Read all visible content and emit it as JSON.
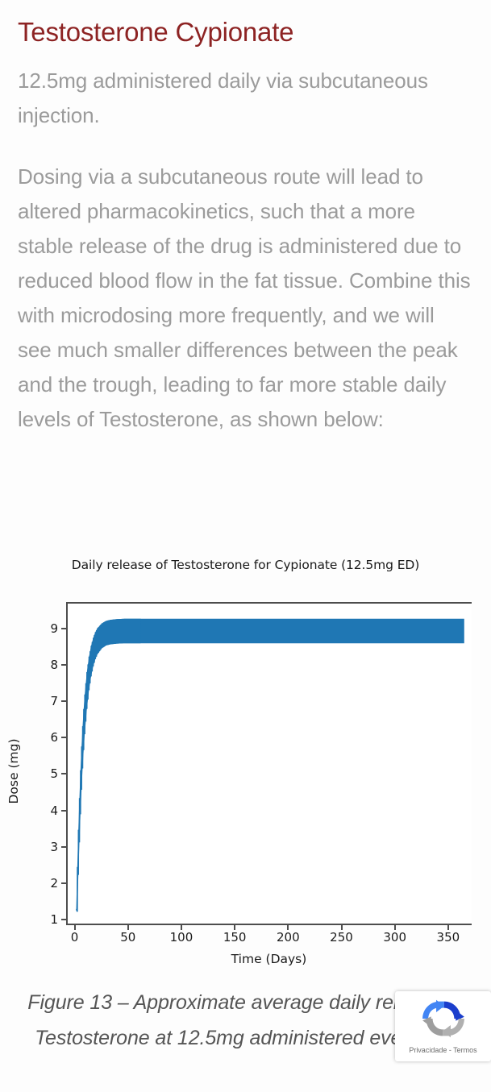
{
  "article": {
    "title": "Testosterone Cypionate",
    "lead": "12.5mg administered daily via subcutaneous injection.",
    "body": "Dosing via a subcutaneous route will lead to altered pharmacokinetics, such that a more stable release of the drug is administered due to reduced blood flow in the fat tissue. Combine this with microdosing more frequently, and we will see much smaller differences between the peak and the trough, leading to far more stable daily levels of Testosterone, as shown below:"
  },
  "figure": {
    "caption": "Figure 13 – Approximate average daily release of Testosterone at 12.5mg administered every day"
  },
  "recaptcha": {
    "privacy_terms": "Privacidade - Termos",
    "icon": "recaptcha-icon"
  },
  "colors": {
    "heading": "#8d2323",
    "body_text": "#9b9b9b",
    "series": "#1f77b4",
    "axis": "#4d4d4d",
    "background": "#fdfdfd"
  },
  "chart_data": {
    "type": "line",
    "title": "Daily release of Testosterone for Cypionate (12.5mg ED)",
    "xlabel": "Time (Days)",
    "ylabel": "Dose (mg)",
    "xlim": [
      -8,
      372
    ],
    "ylim": [
      0.85,
      9.72
    ],
    "xticks": [
      0,
      50,
      100,
      150,
      200,
      250,
      300,
      350
    ],
    "xtick_labels": [
      "0",
      "50",
      "100",
      "150",
      "200",
      "250",
      "300",
      "350"
    ],
    "yticks": [
      1,
      2,
      3,
      4,
      5,
      6,
      7,
      8,
      9
    ],
    "ytick_labels": [
      "1",
      "2",
      "3",
      "4",
      "5",
      "6",
      "7",
      "8",
      "9"
    ],
    "grid": false,
    "legend": null,
    "series": [
      {
        "name": "Daily release",
        "color": "#1f77b4",
        "description": "Daily sawtooth release profile rising from a first-dose value of about 1.25 mg and saturating into a narrow steady-state band; each day the level peaks just after injection and troughs just before the next one.",
        "steady_state_peak": 9.3,
        "steady_state_trough": 8.62,
        "initial_value": 1.25,
        "approx_steady_state_day": 45,
        "peak_envelope": [
          {
            "x": 0,
            "y": 1.25
          },
          {
            "x": 1,
            "y": 2.42
          },
          {
            "x": 2,
            "y": 3.45
          },
          {
            "x": 3,
            "y": 4.33
          },
          {
            "x": 4,
            "y": 5.1
          },
          {
            "x": 5,
            "y": 5.76
          },
          {
            "x": 6,
            "y": 6.32
          },
          {
            "x": 7,
            "y": 6.8
          },
          {
            "x": 8,
            "y": 7.2
          },
          {
            "x": 10,
            "y": 7.82
          },
          {
            "x": 12,
            "y": 8.25
          },
          {
            "x": 14,
            "y": 8.55
          },
          {
            "x": 16,
            "y": 8.77
          },
          {
            "x": 18,
            "y": 8.93
          },
          {
            "x": 20,
            "y": 9.04
          },
          {
            "x": 24,
            "y": 9.17
          },
          {
            "x": 28,
            "y": 9.24
          },
          {
            "x": 32,
            "y": 9.27
          },
          {
            "x": 38,
            "y": 9.29
          },
          {
            "x": 45,
            "y": 9.3
          },
          {
            "x": 60,
            "y": 9.3
          },
          {
            "x": 100,
            "y": 9.3
          },
          {
            "x": 200,
            "y": 9.3
          },
          {
            "x": 300,
            "y": 9.3
          },
          {
            "x": 365,
            "y": 9.3
          }
        ],
        "trough_envelope": [
          {
            "x": 0,
            "y": 1.25
          },
          {
            "x": 1,
            "y": 1.18
          },
          {
            "x": 2,
            "y": 2.2
          },
          {
            "x": 3,
            "y": 3.1
          },
          {
            "x": 4,
            "y": 3.88
          },
          {
            "x": 5,
            "y": 4.56
          },
          {
            "x": 6,
            "y": 5.15
          },
          {
            "x": 7,
            "y": 5.66
          },
          {
            "x": 8,
            "y": 6.1
          },
          {
            "x": 10,
            "y": 6.8
          },
          {
            "x": 12,
            "y": 7.32
          },
          {
            "x": 14,
            "y": 7.7
          },
          {
            "x": 16,
            "y": 7.98
          },
          {
            "x": 18,
            "y": 8.18
          },
          {
            "x": 20,
            "y": 8.32
          },
          {
            "x": 24,
            "y": 8.48
          },
          {
            "x": 28,
            "y": 8.56
          },
          {
            "x": 32,
            "y": 8.59
          },
          {
            "x": 38,
            "y": 8.61
          },
          {
            "x": 45,
            "y": 8.62
          },
          {
            "x": 60,
            "y": 8.62
          },
          {
            "x": 100,
            "y": 8.62
          },
          {
            "x": 200,
            "y": 8.62
          },
          {
            "x": 300,
            "y": 8.62
          },
          {
            "x": 365,
            "y": 8.62
          }
        ]
      }
    ]
  }
}
